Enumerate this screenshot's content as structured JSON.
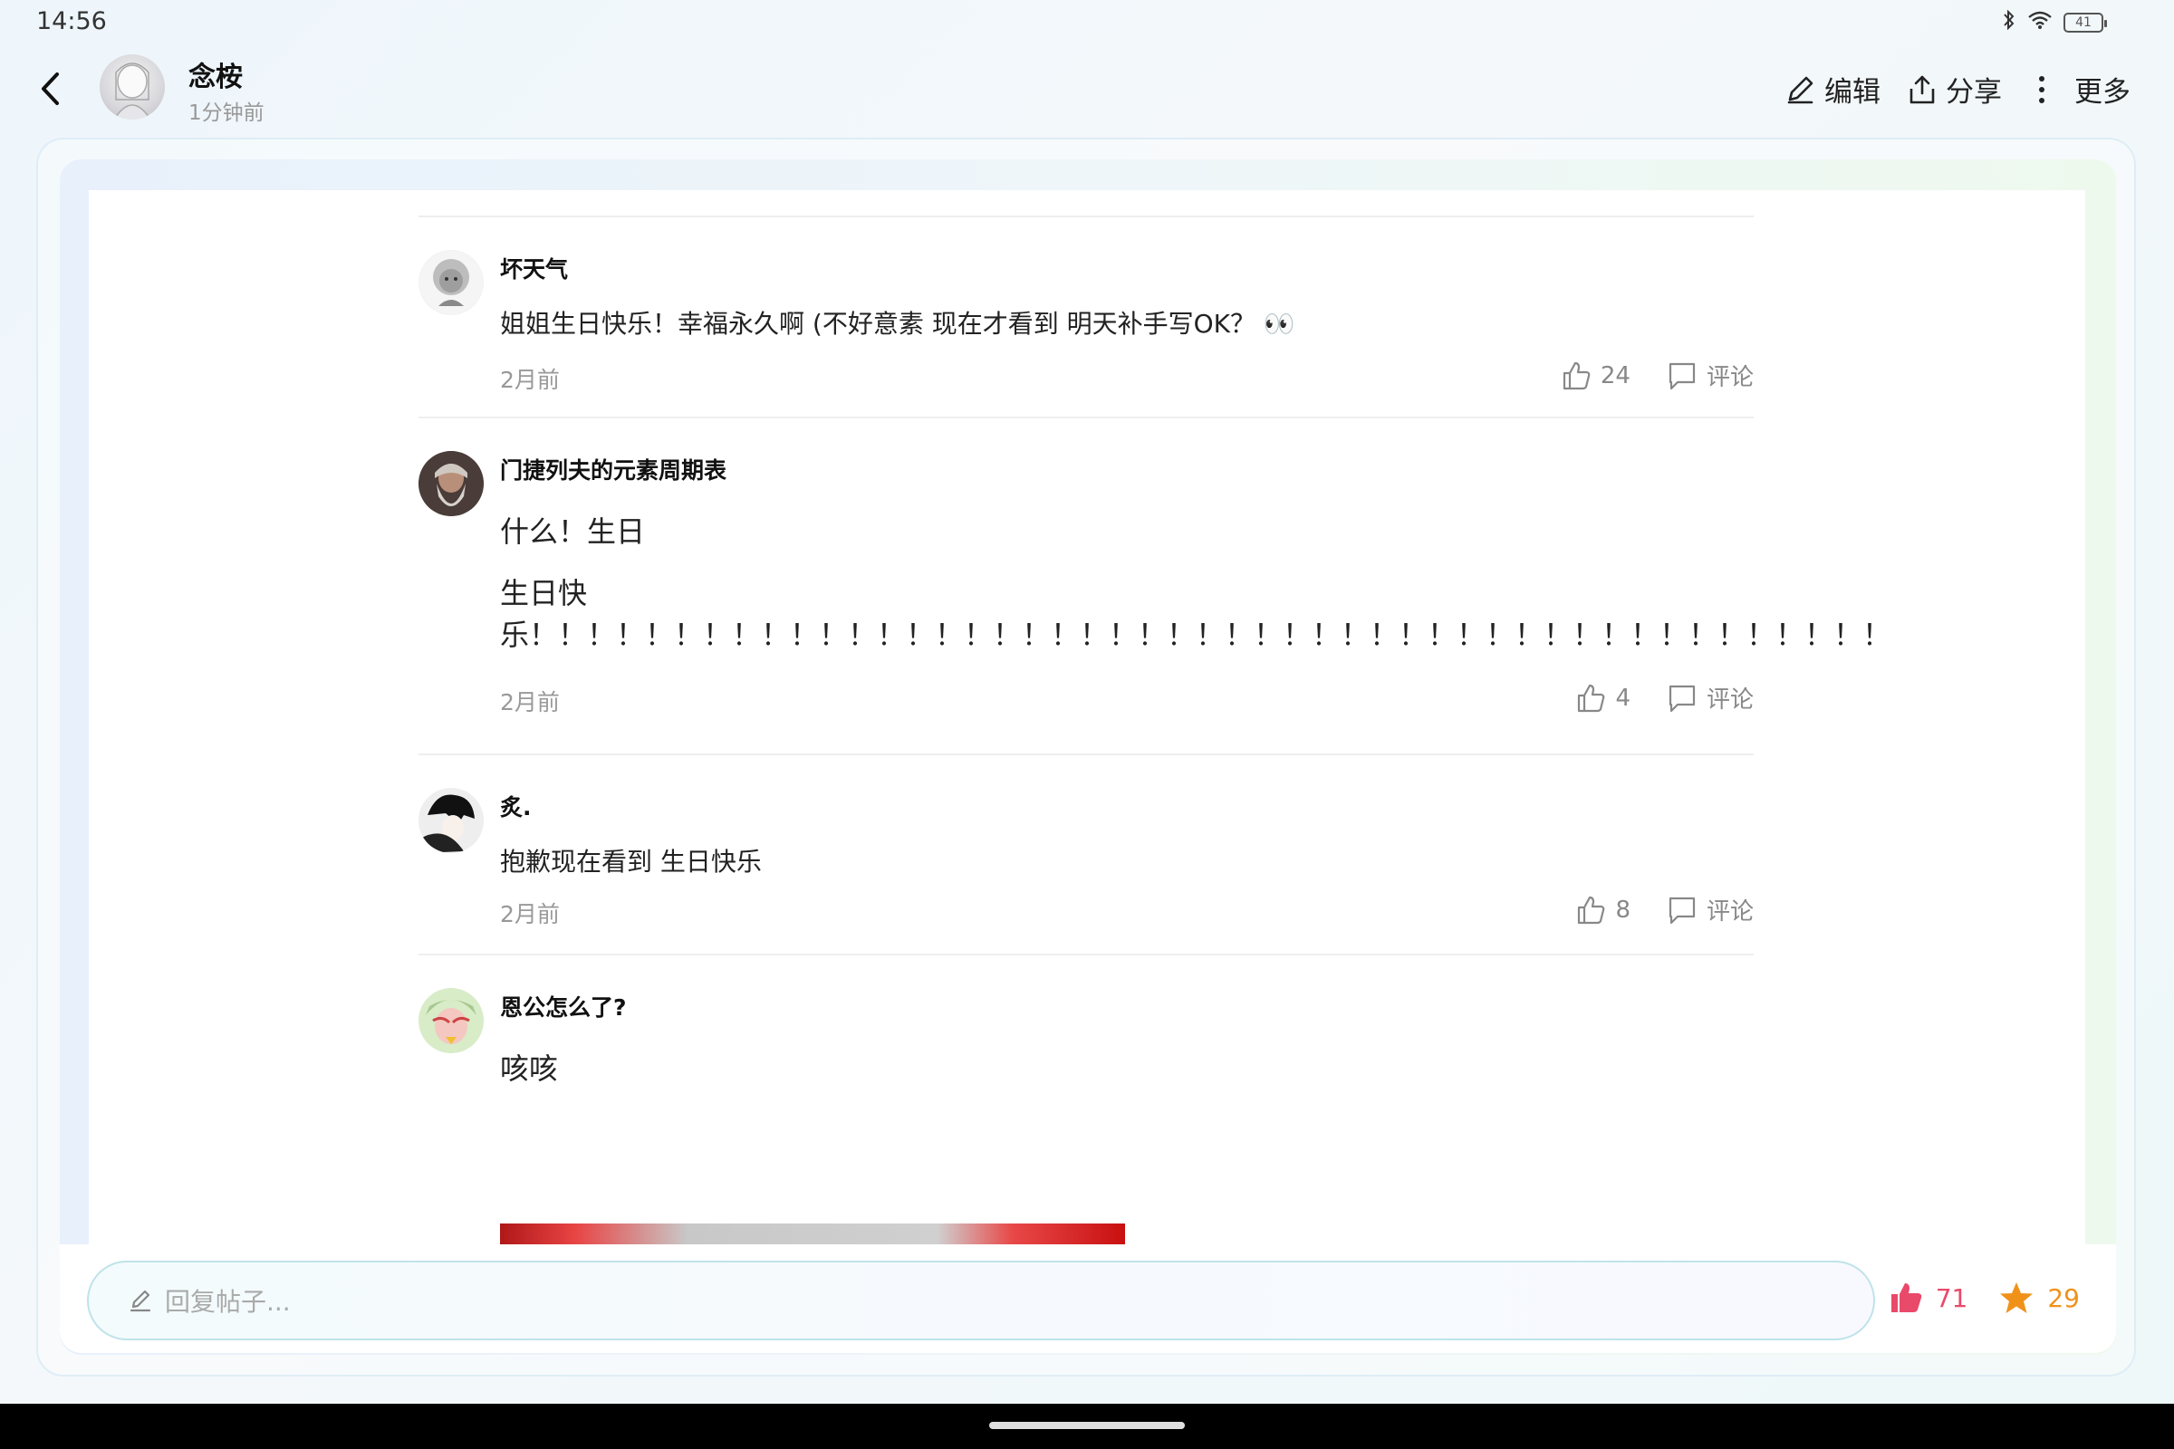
{
  "status_bar": {
    "time": "14:56",
    "battery": "41"
  },
  "header": {
    "author_name": "念桉",
    "post_time": "1分钟前",
    "actions": {
      "edit": "编辑",
      "share": "分享",
      "more": "更多"
    }
  },
  "comments": [
    {
      "name": "坏天气",
      "paragraphs": [
        "姐姐生日快乐！幸福永久啊 (不好意素 现在才看到 明天补手写OK？ 👀"
      ],
      "time": "2月前",
      "likes": "24",
      "comment_label": "评论"
    },
    {
      "name": "门捷列夫的元素周期表",
      "paragraphs": [
        "什么！生日",
        "生日快乐！！！！！！！！！！！！！！！！！！！！！！！！！！！！！！！！！！！！！！！！！！！！！！！"
      ],
      "time": "2月前",
      "likes": "4",
      "comment_label": "评论"
    },
    {
      "name": "炙.",
      "paragraphs": [
        "抱歉现在看到 生日快乐"
      ],
      "time": "2月前",
      "likes": "8",
      "comment_label": "评论"
    },
    {
      "name": "恩公怎么了?",
      "paragraphs": [
        "咳咳"
      ]
    }
  ],
  "bottom_bar": {
    "reply_placeholder": "回复帖子...",
    "like_count": "71",
    "favorite_count": "29"
  },
  "colors": {
    "like": "#e94a6a",
    "favorite": "#f0921a",
    "muted_text": "#999999"
  }
}
